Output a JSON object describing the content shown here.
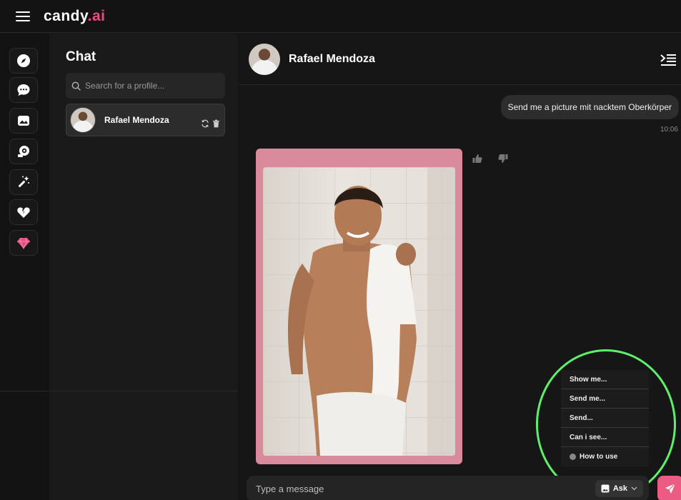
{
  "brand": {
    "name": "candy",
    "suffix": ".ai",
    "accent": "#ec4a7e"
  },
  "rail": {
    "items": [
      {
        "icon": "compass-icon"
      },
      {
        "icon": "chat-bubble-icon"
      },
      {
        "icon": "gallery-icon"
      },
      {
        "icon": "webcam-icon"
      },
      {
        "icon": "magic-wand-icon"
      },
      {
        "icon": "broken-heart-icon"
      },
      {
        "icon": "diamond-icon",
        "color": "#ec4a7e"
      }
    ]
  },
  "chat_list": {
    "title": "Chat",
    "search_placeholder": "Search for a profile...",
    "items": [
      {
        "name": "Rafael Mendoza"
      }
    ]
  },
  "conversation": {
    "contact_name": "Rafael Mendoza",
    "messages": [
      {
        "from": "user",
        "text": "Send me a picture mit nacktem Oberkörper",
        "time": "10:06"
      }
    ]
  },
  "suggestions": {
    "items": [
      "Show me...",
      "Send me...",
      "Send...",
      "Can i see..."
    ],
    "help_label": "How to use"
  },
  "composer": {
    "placeholder": "Type a message",
    "ask_label": "Ask"
  },
  "colors": {
    "image_frame": "#d98a9d",
    "send_button": "#ec5b84",
    "highlight": "#5ef06a"
  }
}
